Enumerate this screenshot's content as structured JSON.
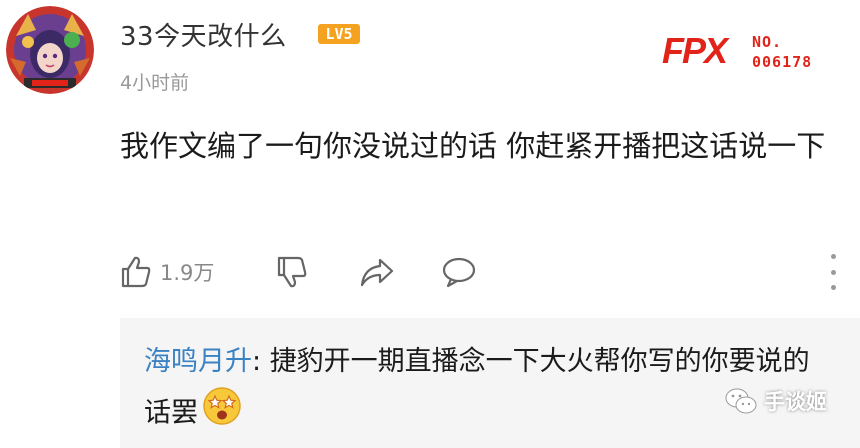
{
  "user": {
    "name": "33今天改什么",
    "level": "LV5",
    "time": "4小时前",
    "avatar_icon": "anime-avatar-icon"
  },
  "fan_badge": {
    "logo_text": "FPX",
    "label": "NO.",
    "number": "006178",
    "color": "#e2231a"
  },
  "comment": {
    "text": "我作文编了一句你没说过的话 你赶紧开播把这话说一下"
  },
  "actions": {
    "like_count": "1.9万",
    "icons": [
      "thumb-up-icon",
      "thumb-down-icon",
      "share-icon",
      "comment-icon",
      "more-icon"
    ]
  },
  "reply": {
    "user": "海鸣月升",
    "separator": ": ",
    "text": "捷豹开一期直播念一下大火帮你写的你要说的话罢",
    "emoji": "starstruck-face-icon"
  },
  "watermark": {
    "name": "手谈姬",
    "icon": "wechat-icon"
  },
  "colors": {
    "level_badge": "#f4a21f",
    "reply_user": "#3b82c4",
    "reply_bg": "#f5f5f5"
  }
}
